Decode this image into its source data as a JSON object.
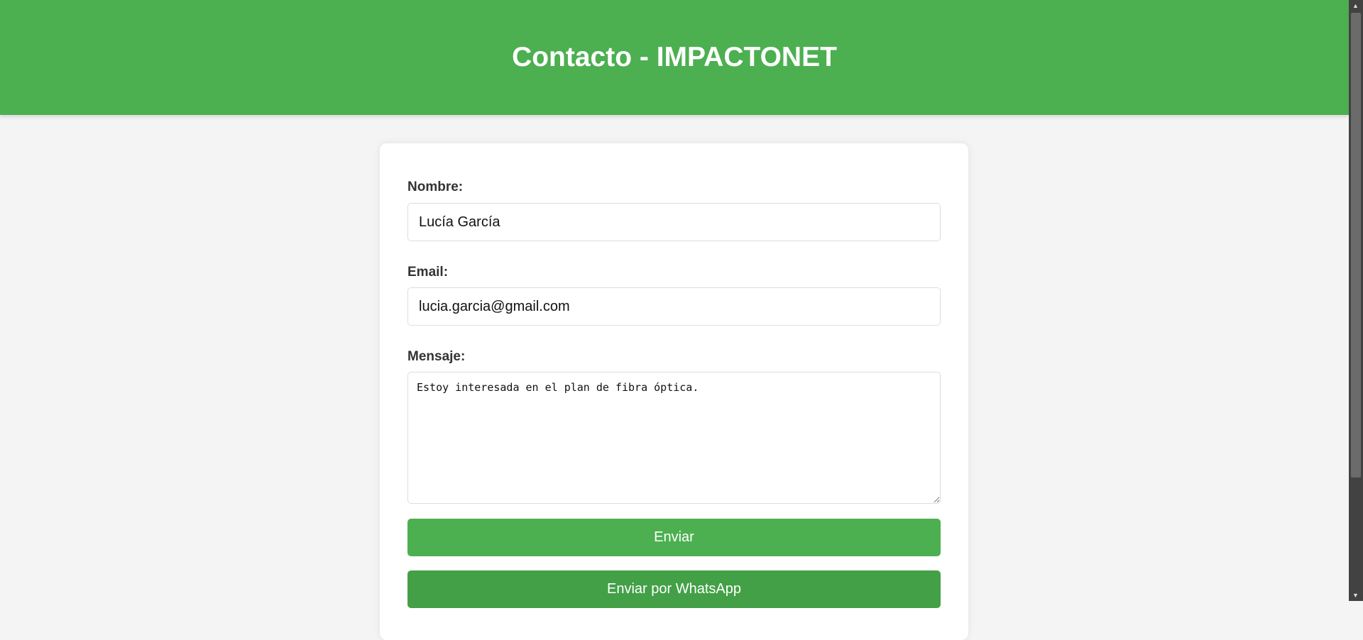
{
  "header": {
    "title": "Contacto - IMPACTONET"
  },
  "form": {
    "name_label": "Nombre:",
    "name_value": "Lucía García",
    "email_label": "Email:",
    "email_value": "lucia.garcia@gmail.com",
    "message_label": "Mensaje:",
    "message_value": "Estoy interesada en el plan de fibra óptica.",
    "submit_label": "Enviar",
    "whatsapp_label": "Enviar por WhatsApp"
  },
  "colors": {
    "brand": "#4caf50",
    "whatsapp_button": "#43a047",
    "background": "#f4f4f4"
  },
  "icons": {
    "scroll_up": "triangle-up-icon",
    "scroll_down": "triangle-down-icon"
  }
}
